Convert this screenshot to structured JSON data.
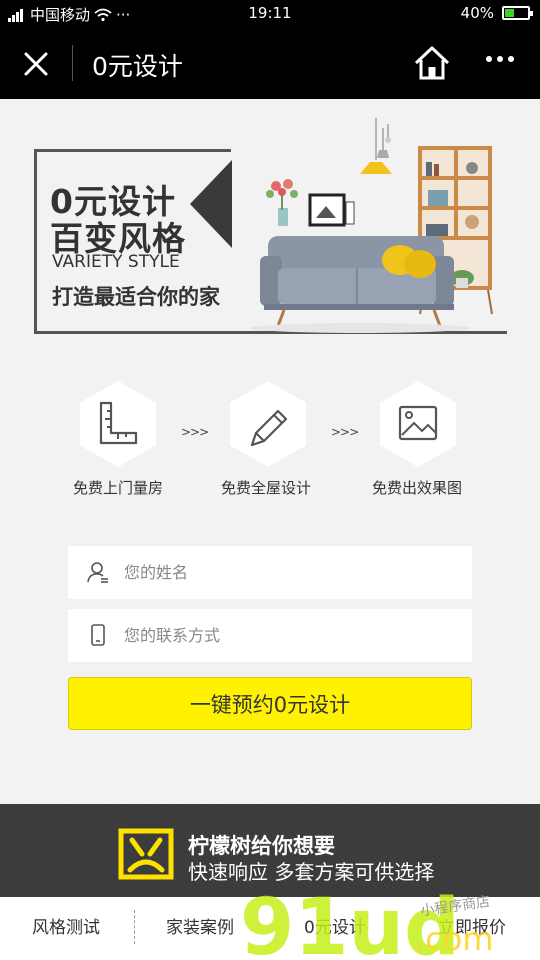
{
  "status_bar": {
    "carrier": "中国移动",
    "dots": "···",
    "time": "19:11",
    "battery_percent": "40%",
    "battery_level": 0.4,
    "battery_color": "#3cd12a"
  },
  "nav": {
    "title": "0元设计",
    "close_icon": "close-icon",
    "home_icon": "home-icon",
    "more_icon": "more-icon"
  },
  "banner": {
    "title_line1": "0元设计",
    "title_line2": "百变风格",
    "subtitle_en": "VARIETY STYLE",
    "slogan": "打造最适合你的家"
  },
  "steps": [
    {
      "label": "免费上门量房",
      "icon": "ruler-icon"
    },
    {
      "label": "免费全屋设计",
      "icon": "pencil-icon"
    },
    {
      "label": "免费出效果图",
      "icon": "image-icon"
    }
  ],
  "step_arrow": ">>>",
  "form": {
    "name_placeholder": "您的姓名",
    "name_value": "",
    "phone_placeholder": "您的联系方式",
    "phone_value": "",
    "submit_label": "一键预约0元设计",
    "submit_color": "#fff200"
  },
  "promo": {
    "line1": "柠檬树给你想要",
    "line2": "快速响应 多套方案可供选择",
    "logo_color": "#ffe100"
  },
  "tabs": [
    {
      "label": "风格测试"
    },
    {
      "label": "家装案例"
    },
    {
      "label": "0元设计"
    },
    {
      "label": "立即报价"
    }
  ],
  "watermark": {
    "text": "91ud",
    "suffix": ".com",
    "script": "小程序商店"
  }
}
